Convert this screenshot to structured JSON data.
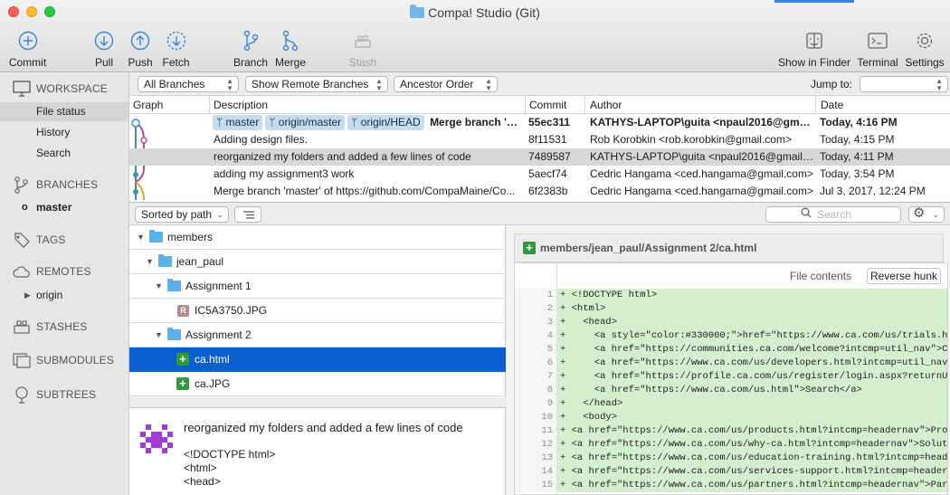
{
  "window": {
    "title": "Compa! Studio (Git)"
  },
  "toolbar": {
    "commit": "Commit",
    "pull": "Pull",
    "push": "Push",
    "fetch": "Fetch",
    "branch": "Branch",
    "merge": "Merge",
    "stash": "Stash",
    "show_in_finder": "Show in Finder",
    "terminal": "Terminal",
    "settings": "Settings"
  },
  "sidebar": {
    "workspace": "WORKSPACE",
    "file_status": "File status",
    "history": "History",
    "search": "Search",
    "branches": "BRANCHES",
    "branch_master": "master",
    "tags": "TAGS",
    "remotes": "REMOTES",
    "remote_origin": "origin",
    "stashes": "STASHES",
    "submodules": "SUBMODULES",
    "subtrees": "SUBTREES"
  },
  "filters": {
    "branches": "All Branches",
    "remote": "Show Remote Branches",
    "order": "Ancestor Order",
    "jump_to": "Jump to:"
  },
  "table": {
    "headers": {
      "graph": "Graph",
      "description": "Description",
      "commit": "Commit",
      "author": "Author",
      "date": "Date"
    },
    "rows": [
      {
        "tags": [
          "master",
          "origin/master",
          "origin/HEAD"
        ],
        "description": "Merge branch 'm...",
        "commit": "55ec311",
        "author": "KATHYS-LAPTOP\\guita <npaul2016@gmai...",
        "date": "Today, 4:16 PM"
      },
      {
        "description": "Adding design files.",
        "commit": "8f11531",
        "author": "Rob Korobkin <rob.korobkin@gmail.com>",
        "date": "Today, 4:15 PM"
      },
      {
        "description": "reorganized my folders and added a few lines of code",
        "commit": "7489587",
        "author": "KATHYS-LAPTOP\\guita <npaul2016@gmail.c...",
        "date": "Today, 4:11 PM"
      },
      {
        "description": "adding my assignment3 work",
        "commit": "5aecf74",
        "author": "Cedric Hangama <ced.hangama@gmail.com>",
        "date": "Today, 3:54 PM"
      },
      {
        "description": "Merge branch 'master' of https://github.com/CompaMaine/Co...",
        "commit": "6f2383b",
        "author": "Cedric Hangama <ced.hangama@gmail.com>",
        "date": "Jul 3, 2017, 12:24 PM"
      }
    ]
  },
  "files": {
    "sort_label": "Sorted by path",
    "search_placeholder": "Search",
    "tree": [
      {
        "name": "members"
      },
      {
        "name": "jean_paul"
      },
      {
        "name": "Assignment 1"
      },
      {
        "name": "IC5A3750.JPG"
      },
      {
        "name": "Assignment 2"
      },
      {
        "name": "ca.html"
      },
      {
        "name": "ca.JPG"
      }
    ]
  },
  "commit_message": {
    "summary": "reorganized my folders and added a few lines of code",
    "body": [
      "<!DOCTYPE html>",
      "<html>",
      "<head>"
    ]
  },
  "diff": {
    "path": "members/jean_paul/Assignment 2/ca.html",
    "file_contents": "File contents",
    "reverse_hunk": "Reverse hunk",
    "lines": [
      {
        "n": "1",
        "t": "+ <!DOCTYPE html>"
      },
      {
        "n": "2",
        "t": "+ <html>"
      },
      {
        "n": "3",
        "t": "+   <head>"
      },
      {
        "n": "4",
        "t": "+     <a style=\"color:#330000;\">href=\"https://www.ca.com/us/trials.html"
      },
      {
        "n": "5",
        "t": "+     <a href=\"https://communities.ca.com/welcome?intcmp=util_nav\">Comm"
      },
      {
        "n": "6",
        "t": "+     <a href=\"https://www.ca.com/us/developers.html?intcmp=util_nav\">C"
      },
      {
        "n": "7",
        "t": "+     <a href=\"https://profile.ca.com/us/register/login.aspx?returnURL="
      },
      {
        "n": "8",
        "t": "+     <a href=\"https://www.ca.com/us.html\">Search</a>"
      },
      {
        "n": "9",
        "t": "+   </head>"
      },
      {
        "n": "10",
        "t": "+   <body>"
      },
      {
        "n": "11",
        "t": "+ <a href=\"https://www.ca.com/us/products.html?intcmp=headernav\">Produc"
      },
      {
        "n": "12",
        "t": "+ <a href=\"https://www.ca.com/us/why-ca.html?intcmp=headernav\">Solution"
      },
      {
        "n": "13",
        "t": "+ <a href=\"https://www.ca.com/us/education-training.html?intcmp=headern"
      },
      {
        "n": "14",
        "t": "+ <a href=\"https://www.ca.com/us/services-support.html?intcmp=headernav"
      },
      {
        "n": "15",
        "t": "+ <a href=\"https://www.ca.com/us/partners.html?intcmp=headernav\">Partne"
      }
    ]
  },
  "colors": {
    "accent": "#0a5fd0",
    "added_line": "#d3efcd",
    "tag": "#c5dcf0",
    "added_badge": "#2f9a3c"
  }
}
